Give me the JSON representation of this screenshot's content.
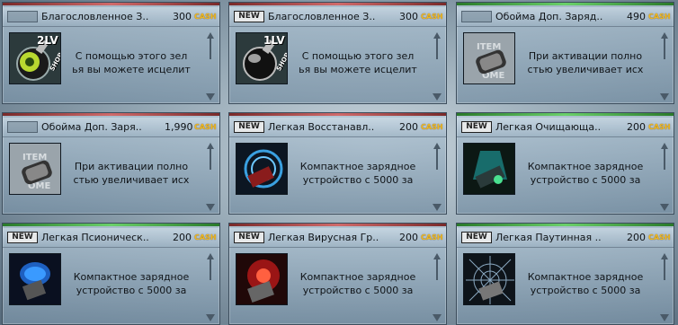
{
  "currency": "CASH",
  "new_badge": "NEW",
  "level_suffix": "LV",
  "shop_mark": "SHOP",
  "cards": [
    {
      "title": "Благословленное З..",
      "price": "300",
      "new": false,
      "line": "red",
      "thumb": "potion-lv2",
      "level": "2",
      "desc1": "С помощью этого зел",
      "desc2": "ья вы можете исцелит"
    },
    {
      "title": "Благословленное З..",
      "price": "300",
      "new": true,
      "line": "red",
      "thumb": "potion-lv1",
      "level": "1",
      "desc1": "С помощью этого зел",
      "desc2": "ья вы можете исцелит"
    },
    {
      "title": "Обойма Доп. Заряд..",
      "price": "490",
      "new": false,
      "line": "green",
      "thumb": "clip-item",
      "level": "",
      "desc1": "При активации полно",
      "desc2": "стью увеличивает исх"
    },
    {
      "title": "Обойма Доп. Заря..",
      "price": "1,990",
      "new": false,
      "line": "red",
      "thumb": "clip-item",
      "level": "",
      "desc1": "При активации полно",
      "desc2": "стью увеличивает исх"
    },
    {
      "title": "Легкая Восстанавл..",
      "price": "200",
      "new": true,
      "line": "red",
      "thumb": "heal-charger",
      "level": "",
      "desc1": "Компактное зарядное",
      "desc2": "устройство с 5000 за"
    },
    {
      "title": "Легкая Очищающа..",
      "price": "200",
      "new": true,
      "line": "green",
      "thumb": "cleanse-charger",
      "level": "",
      "desc1": "Компактное зарядное",
      "desc2": "устройство с 5000 за"
    },
    {
      "title": "Легкая Псионическ..",
      "price": "200",
      "new": true,
      "line": "green",
      "thumb": "psionic-charger",
      "level": "",
      "desc1": "Компактное зарядное",
      "desc2": "устройство с 5000 за"
    },
    {
      "title": "Легкая Вирусная Гр..",
      "price": "200",
      "new": true,
      "line": "red",
      "thumb": "virus-charger",
      "level": "",
      "desc1": "Компактное зарядное",
      "desc2": "устройство с 5000 за"
    },
    {
      "title": "Легкая Паутинная ..",
      "price": "200",
      "new": true,
      "line": "green",
      "thumb": "web-charger",
      "level": "",
      "desc1": "Компактное зарядное",
      "desc2": "устройство с 5000 за"
    }
  ]
}
